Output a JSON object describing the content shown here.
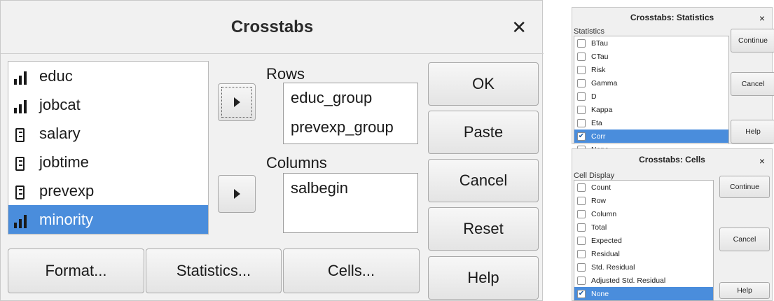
{
  "main": {
    "title": "Crosstabs",
    "close": "✕",
    "variables": [
      {
        "name": "educ",
        "icon": "ordinal-bars-icon",
        "selected": false
      },
      {
        "name": "jobcat",
        "icon": "ordinal-bars-icon",
        "selected": false
      },
      {
        "name": "salary",
        "icon": "scale-ruler-icon",
        "selected": false
      },
      {
        "name": "jobtime",
        "icon": "scale-ruler-icon",
        "selected": false
      },
      {
        "name": "prevexp",
        "icon": "scale-ruler-icon",
        "selected": false
      },
      {
        "name": "minority",
        "icon": "ordinal-bars-icon",
        "selected": true
      }
    ],
    "rows_label": "Rows",
    "rows": [
      "educ_group",
      "prevexp_group"
    ],
    "columns_label": "Columns",
    "columns": [
      "salbegin"
    ],
    "buttons": {
      "ok": "OK",
      "paste": "Paste",
      "cancel": "Cancel",
      "reset": "Reset",
      "help": "Help",
      "format": "Format...",
      "statistics": "Statistics...",
      "cells": "Cells..."
    }
  },
  "statistics_dialog": {
    "title": "Crosstabs: Statistics",
    "close": "×",
    "group_label": "Statistics",
    "items": [
      {
        "label": "BTau",
        "checked": false
      },
      {
        "label": "CTau",
        "checked": false
      },
      {
        "label": "Risk",
        "checked": false
      },
      {
        "label": "Gamma",
        "checked": false
      },
      {
        "label": "D",
        "checked": false
      },
      {
        "label": "Kappa",
        "checked": false
      },
      {
        "label": "Eta",
        "checked": false
      },
      {
        "label": "Corr",
        "checked": true
      },
      {
        "label": "None",
        "checked": false
      }
    ],
    "buttons": {
      "continue": "Continue",
      "cancel": "Cancel",
      "help": "Help"
    }
  },
  "cells_dialog": {
    "title": "Crosstabs: Cells",
    "close": "×",
    "group_label": "Cell Display",
    "items": [
      {
        "label": "Count",
        "checked": false
      },
      {
        "label": "Row",
        "checked": false
      },
      {
        "label": "Column",
        "checked": false
      },
      {
        "label": "Total",
        "checked": false
      },
      {
        "label": "Expected",
        "checked": false
      },
      {
        "label": "Residual",
        "checked": false
      },
      {
        "label": "Std. Residual",
        "checked": false
      },
      {
        "label": "Adjusted Std. Residual",
        "checked": false
      },
      {
        "label": "None",
        "checked": true
      }
    ],
    "buttons": {
      "continue": "Continue",
      "cancel": "Cancel",
      "help": "Help"
    }
  },
  "colors": {
    "selection": "#4a8ddc",
    "dialog_bg": "#f1f1f1"
  }
}
